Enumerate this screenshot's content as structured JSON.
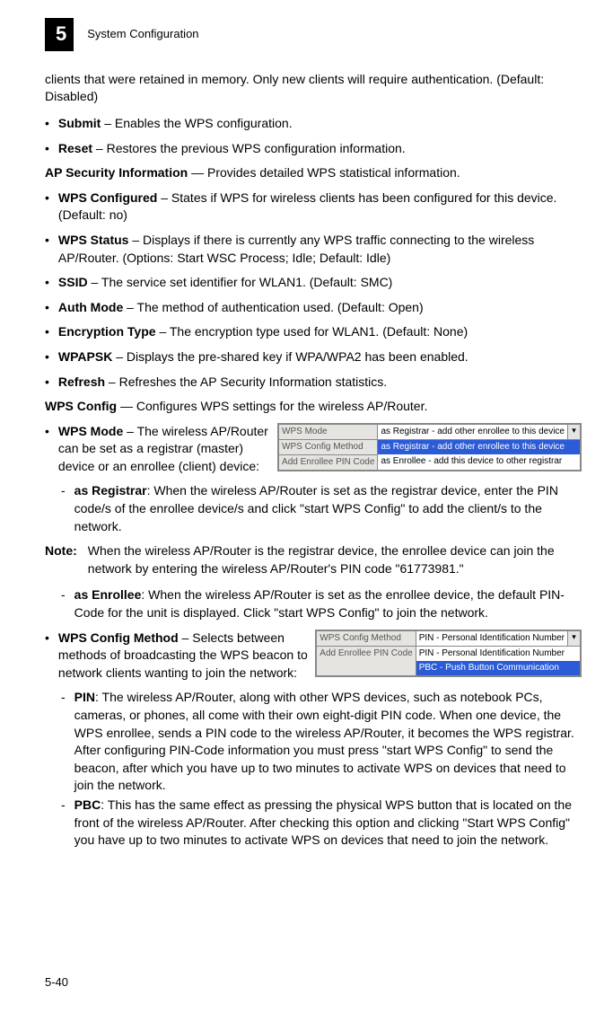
{
  "header": {
    "chapter_num": "5",
    "chapter_title": "System Configuration"
  },
  "intro_para": "clients that were retained in memory. Only new clients will require authentication. (Default: Disabled)",
  "bullets_top": [
    {
      "label": "Submit",
      "text": " – Enables the WPS configuration."
    },
    {
      "label": "Reset",
      "text": " – Restores the previous WPS configuration information."
    }
  ],
  "ap_security_lead": {
    "label": "AP Security Information",
    "text": " — Provides detailed WPS statistical information."
  },
  "ap_security_bullets": [
    {
      "label": "WPS Configured",
      "text": " – States if WPS for wireless clients has been configured for this device. (Default: no)"
    },
    {
      "label": "WPS Status",
      "text": " – Displays if there is currently any WPS traffic connecting to the wireless AP/Router. (Options: Start WSC Process; Idle; Default: Idle)"
    },
    {
      "label": "SSID",
      "text": " – The service set identifier for WLAN1. (Default: SMC)"
    },
    {
      "label": "Auth Mode",
      "text": " – The method of authentication used. (Default: Open)"
    },
    {
      "label": "Encryption Type",
      "text": " – The encryption type used for WLAN1. (Default: None)"
    },
    {
      "label": "WPAPSK",
      "text": " – Displays the pre-shared key if WPA/WPA2 has been enabled."
    },
    {
      "label": "Refresh",
      "text": " – Refreshes the AP Security Information statistics."
    }
  ],
  "wps_config_lead": {
    "label": "WPS Config",
    "text": " — Configures WPS settings for the wireless AP/Router."
  },
  "wps_mode_bullet": {
    "label": "WPS Mode",
    "text": " – The wireless AP/Router can be set as a registrar (master) device or an enrollee (client) device:"
  },
  "wps_mode_img": {
    "rows": [
      {
        "label": "WPS Mode",
        "selected": "as Registrar - add other enrollee to this device"
      },
      {
        "label": "WPS Config Method"
      },
      {
        "label": "Add Enrollee PIN Code"
      }
    ],
    "dropdown": [
      {
        "text": "as Registrar - add other enrollee to this device",
        "hl": true
      },
      {
        "text": "as Enrollee - add this device to other registrar",
        "hl": false
      }
    ]
  },
  "wps_mode_sub": [
    {
      "label": "as Registrar",
      "text": ": When the wireless AP/Router is set as the registrar device, enter the PIN code/s of the enrollee device/s and click \"start WPS Config\" to add the client/s to the network."
    }
  ],
  "note": {
    "label": "Note:",
    "text": "When the wireless AP/Router is the registrar device, the enrollee device can join the network by entering the wireless AP/Router's PIN code \"61773981.\""
  },
  "wps_mode_sub2": [
    {
      "label": "as Enrollee",
      "text": ": When the wireless AP/Router is set as the enrollee device, the default PIN-Code for the unit is displayed. Click \"start WPS Config\" to join the network."
    }
  ],
  "wps_method_bullet": {
    "label": "WPS Config Method",
    "text": " – Selects between methods of broadcasting the WPS beacon to network clients wanting to join the network:"
  },
  "wps_method_img": {
    "rows": [
      {
        "label": "WPS Config Method",
        "selected": "PIN - Personal Identification Number"
      },
      {
        "label": "Add Enrollee PIN Code"
      }
    ],
    "dropdown": [
      {
        "text": "PIN - Personal Identification Number",
        "hl": false
      },
      {
        "text": "PBC - Push Button Communication",
        "hl": true
      }
    ]
  },
  "wps_method_sub": [
    {
      "label": "PIN",
      "text": ": The wireless AP/Router, along with other WPS devices, such as notebook PCs, cameras, or phones, all come with their own eight-digit PIN code. When one device, the WPS enrollee, sends a PIN code to the wireless AP/Router, it becomes the WPS registrar. After configuring PIN-Code information you must press \"start WPS Config\" to send the beacon, after which you have up to two minutes to activate WPS on devices that need to join the network."
    },
    {
      "label": "PBC",
      "text": ": This has the same effect as pressing the physical WPS button that is located on the front of the wireless AP/Router. After checking this option and clicking \"Start WPS Config\" you have up to two minutes to activate WPS on devices that need to join the network."
    }
  ],
  "page_number": "5-40"
}
